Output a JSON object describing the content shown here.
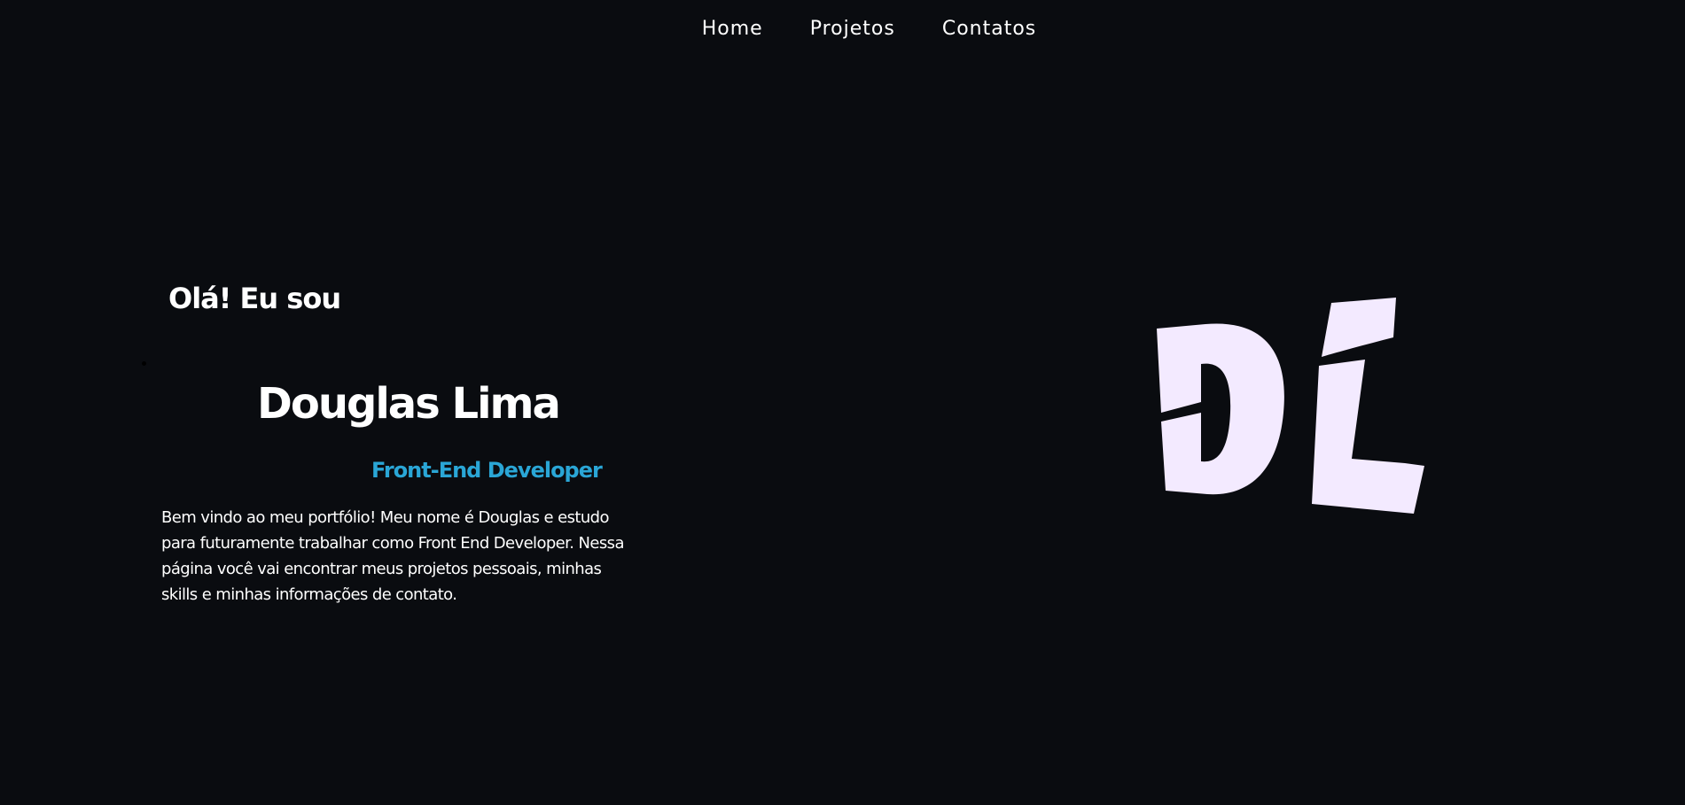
{
  "nav": {
    "links": [
      "Home",
      "Projetos",
      "Contatos"
    ]
  },
  "hero": {
    "greeting": "Olá! Eu sou",
    "name": "Douglas Lima",
    "role": "Front-End Developer",
    "bio": "Bem vindo ao meu portfólio! Meu nome é Douglas e estudo para futuramente trabalhar como Front End Developer. Nessa página você vai encontrar meus projetos pessoais, minhas skills e minhas informações de contato.",
    "logo_text": "DL"
  },
  "colors": {
    "background": "#0a0c10",
    "accent": "#2aa6d6",
    "logo": "#f3eaff",
    "text": "#ffffff"
  }
}
